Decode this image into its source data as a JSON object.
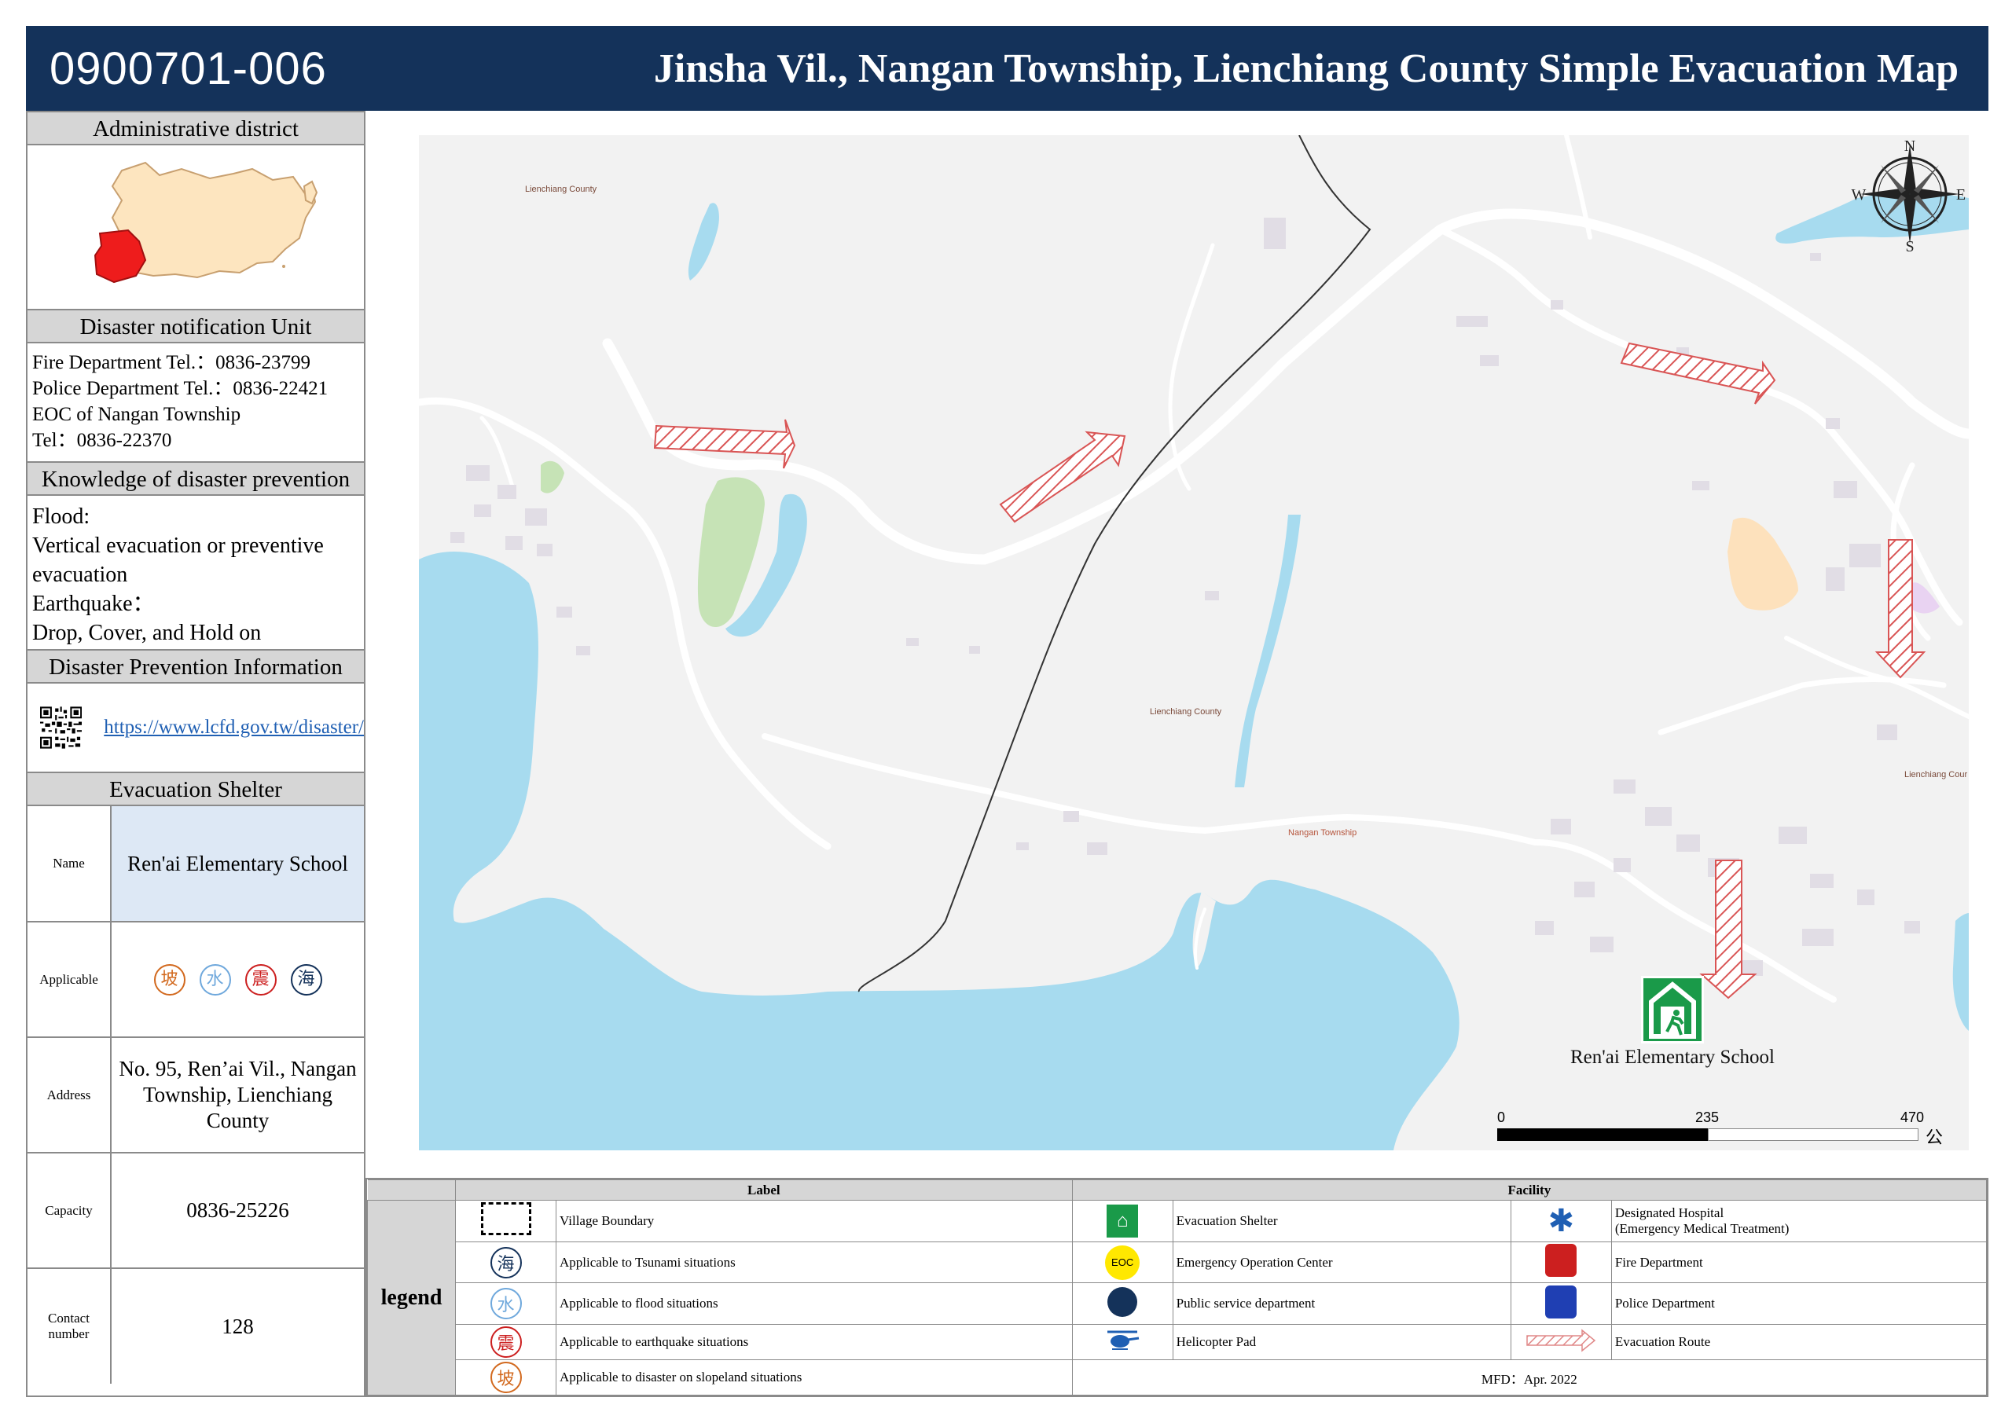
{
  "header": {
    "code": "0900701-006",
    "title": "Jinsha Vil., Nangan Township, Lienchiang County Simple Evacuation Map"
  },
  "sidebar": {
    "admin_district": "Administrative district",
    "notify_title": "Disaster notification Unit",
    "notify_lines": [
      "Fire Department Tel.：0836-23799",
      "Police Department Tel.：0836-22421",
      "EOC of Nangan Township",
      "Tel：0836-22370"
    ],
    "knowledge_title": "Knowledge of disaster prevention",
    "knowledge_lines": [
      "Flood:",
      "Vertical evacuation or preventive evacuation",
      "Earthquake：",
      "Drop, Cover, and Hold on"
    ],
    "info_title": "Disaster Prevention Information",
    "info_link": "https://www.lcfd.gov.tw/disaster/",
    "shelter_title": "Evacuation Shelter",
    "shelter": {
      "name_key": "Name",
      "name_val": "Ren'ai Elementary School",
      "applicable_key": "Applicable",
      "hazards": [
        "坡",
        "水",
        "震",
        "海"
      ],
      "hazard_colors": [
        "#d2691e",
        "#6fa8dc",
        "#cc1f1f",
        "#14325a"
      ],
      "address_key": "Address",
      "address_val": "No. 95, Ren’ai Vil., Nangan Township, Lienchiang County",
      "capacity_key": "Capacity",
      "capacity_val": "0836-25226",
      "contact_key": "Contact number",
      "contact_val": "128"
    }
  },
  "map": {
    "labels": [
      "Lienchiang County",
      "Lienchiang County",
      "Nangan Township",
      "Lienchiang Cour"
    ],
    "compass": {
      "n": "N",
      "s": "S",
      "e": "E",
      "w": "W"
    },
    "shelter_label": "Ren'ai Elementary School",
    "scale": {
      "t0": "0",
      "t1": "235",
      "t2": "470",
      "unit": "公尺"
    }
  },
  "legend": {
    "title": "legend",
    "label_head": "Label",
    "facility_head": "Facility",
    "labels": [
      "Village Boundary",
      "Applicable to Tsunami situations",
      "Applicable to flood situations",
      "Applicable to earthquake situations",
      "Applicable to disaster on slopeland situations"
    ],
    "label_glyphs": [
      "",
      "海",
      "水",
      "震",
      "坡"
    ],
    "facilities_a": [
      "Evacuation Shelter",
      "Emergency Operation Center",
      "Public service department",
      "Helicopter Pad"
    ],
    "eoc_glyph": "EOC",
    "facilities_b_line1": "Designated Hospital",
    "facilities_b_line2": "(Emergency Medical Treatment)",
    "facilities_b": [
      "Fire Department",
      "Police Department",
      "Evacuation Route"
    ],
    "mfd": "MFD：Apr. 2022"
  }
}
